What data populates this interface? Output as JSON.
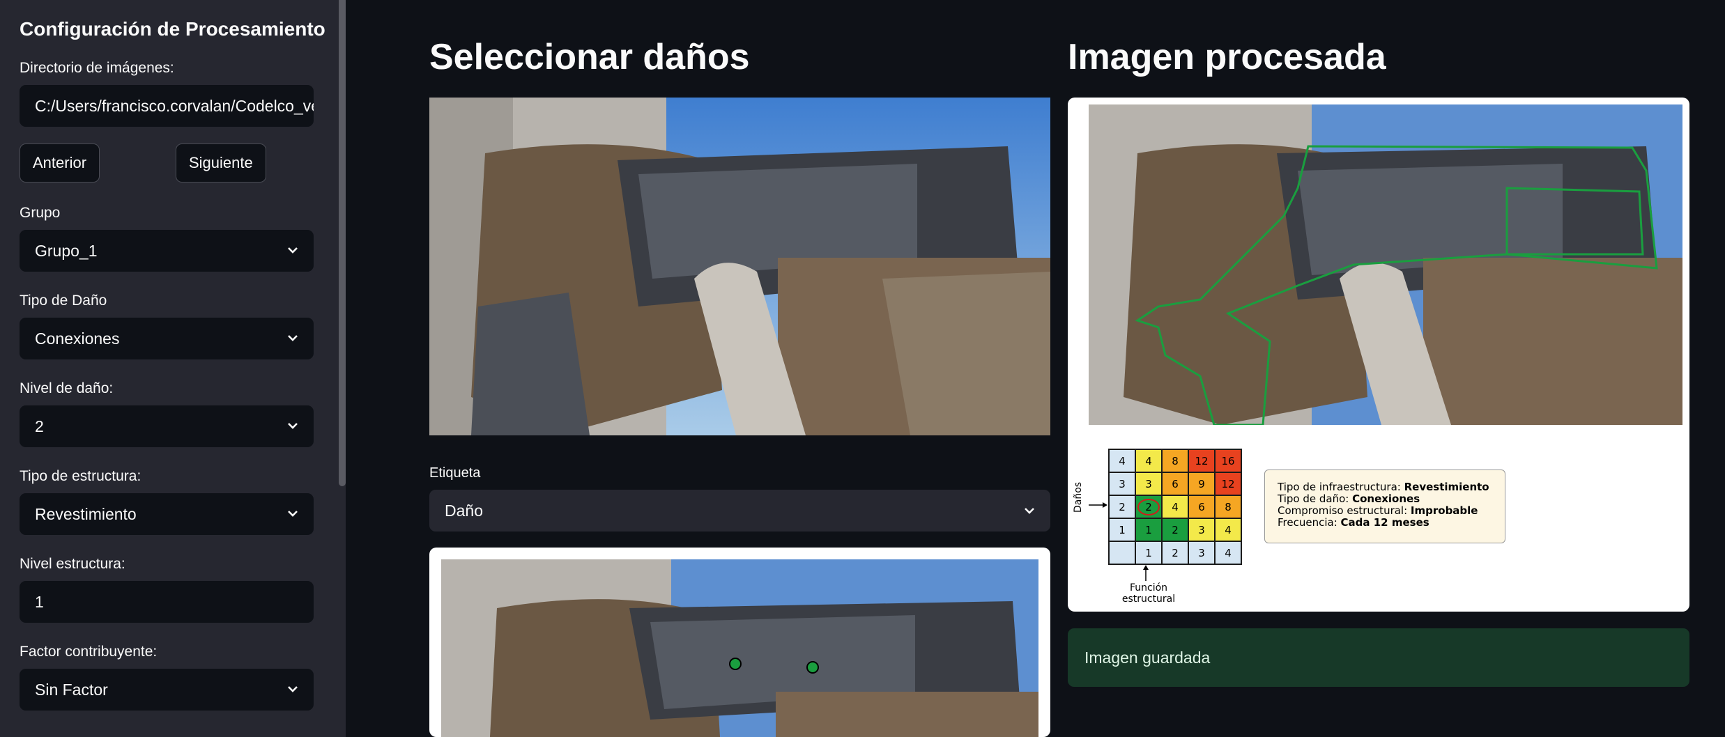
{
  "sidebar": {
    "title": "Configuración de Procesamiento",
    "dir_label": "Directorio de imágenes:",
    "dir_value": "C:/Users/francisco.corvalan/Codelco_ve",
    "prev_button": "Anterior",
    "next_button": "Siguiente",
    "group_label": "Grupo",
    "group_value": "Grupo_1",
    "damage_type_label": "Tipo de Daño",
    "damage_type_value": "Conexiones",
    "damage_level_label": "Nivel de daño:",
    "damage_level_value": "2",
    "structure_type_label": "Tipo de estructura:",
    "structure_type_value": "Revestimiento",
    "structure_level_label": "Nivel estructura:",
    "structure_level_value": "1",
    "factor_label": "Factor contribuyente:",
    "factor_value": "Sin Factor"
  },
  "left": {
    "title": "Seleccionar daños",
    "tag_label": "Etiqueta",
    "tag_value": "Daño"
  },
  "right": {
    "title": "Imagen procesada",
    "saved_message": "Imagen guardada",
    "y_axis_label": "Daños",
    "x_axis_label_1": "Función",
    "x_axis_label_2": "estructural",
    "matrix": [
      [
        "4",
        "4",
        "8",
        "12",
        "16"
      ],
      [
        "3",
        "3",
        "6",
        "9",
        "12"
      ],
      [
        "2",
        "2",
        "4",
        "6",
        "8"
      ],
      [
        "1",
        "1",
        "2",
        "3",
        "4"
      ],
      [
        "",
        "1",
        "2",
        "3",
        "4"
      ]
    ],
    "info": {
      "l1_label": "Tipo de infraestructura: ",
      "l1_value": "Revestimiento",
      "l2_label": "Tipo de daño: ",
      "l2_value": "Conexiones",
      "l3_label": "Compromiso estructural: ",
      "l3_value": "Improbable",
      "l4_label": "Frecuencia: ",
      "l4_value": "Cada 12 meses"
    }
  },
  "colors": {
    "bg": "#0e1117",
    "sidebar": "#262730",
    "success_bg": "#173928",
    "green": "#1a9e3f",
    "yellow": "#f3e94a",
    "orange": "#f5a623",
    "red": "#e8421f",
    "blue": "#d6e6f3"
  }
}
